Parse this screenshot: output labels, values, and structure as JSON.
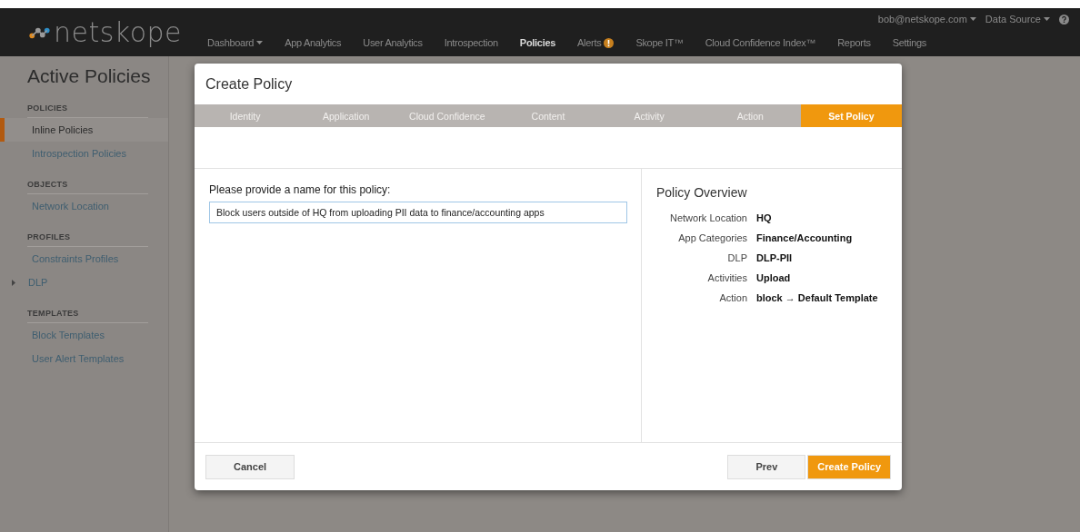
{
  "navbar": {
    "logo": "netskope",
    "items": [
      {
        "label": "Dashboard",
        "dropdown": true,
        "selected": false,
        "alert": false
      },
      {
        "label": "App Analytics",
        "dropdown": false,
        "selected": false,
        "alert": false
      },
      {
        "label": "User Analytics",
        "dropdown": false,
        "selected": false,
        "alert": false
      },
      {
        "label": "Introspection",
        "dropdown": false,
        "selected": false,
        "alert": false
      },
      {
        "label": "Policies",
        "dropdown": false,
        "selected": true,
        "alert": false
      },
      {
        "label": "Alerts",
        "dropdown": false,
        "selected": false,
        "alert": true
      },
      {
        "label": "Skope IT™",
        "dropdown": false,
        "selected": false,
        "alert": false
      },
      {
        "label": "Cloud Confidence Index™",
        "dropdown": false,
        "selected": false,
        "alert": false
      },
      {
        "label": "Reports",
        "dropdown": false,
        "selected": false,
        "alert": false
      },
      {
        "label": "Settings",
        "dropdown": false,
        "selected": false,
        "alert": false
      }
    ],
    "user": "bob@netskope.com",
    "data_source": "Data Source"
  },
  "sidebar": {
    "title": "Active Policies",
    "sections": [
      {
        "heading": "POLICIES",
        "items": [
          {
            "label": "Inline Policies",
            "selected": true,
            "expandable": false
          },
          {
            "label": "Introspection Policies",
            "selected": false,
            "expandable": false
          }
        ]
      },
      {
        "heading": "OBJECTS",
        "items": [
          {
            "label": "Network Location",
            "selected": false,
            "expandable": false
          }
        ]
      },
      {
        "heading": "PROFILES",
        "items": [
          {
            "label": "Constraints Profiles",
            "selected": false,
            "expandable": false
          },
          {
            "label": "DLP",
            "selected": false,
            "expandable": true
          }
        ]
      },
      {
        "heading": "TEMPLATES",
        "items": [
          {
            "label": "Block Templates",
            "selected": false,
            "expandable": false
          },
          {
            "label": "User Alert Templates",
            "selected": false,
            "expandable": false
          }
        ]
      }
    ]
  },
  "dialog": {
    "title": "Create Policy",
    "steps": [
      {
        "label": "Identity",
        "selected": false
      },
      {
        "label": "Application",
        "selected": false
      },
      {
        "label": "Cloud Confidence",
        "selected": false
      },
      {
        "label": "Content",
        "selected": false
      },
      {
        "label": "Activity",
        "selected": false
      },
      {
        "label": "Action",
        "selected": false
      },
      {
        "label": "Set Policy",
        "selected": true
      }
    ],
    "name_label": "Please provide a name for this policy:",
    "name_value": "Block users outside of HQ from uploading PII data to finance/accounting apps",
    "overview": {
      "title": "Policy Overview",
      "rows": [
        {
          "label": "Network Location",
          "value": "HQ"
        },
        {
          "label": "App Categories",
          "value": "Finance/Accounting"
        },
        {
          "label": "DLP",
          "value": "DLP-PII"
        },
        {
          "label": "Activities",
          "value": "Upload"
        },
        {
          "label": "Action",
          "value": "block → Default Template"
        }
      ]
    },
    "buttons": {
      "cancel": "Cancel",
      "prev": "Prev",
      "create": "Create Policy"
    }
  }
}
